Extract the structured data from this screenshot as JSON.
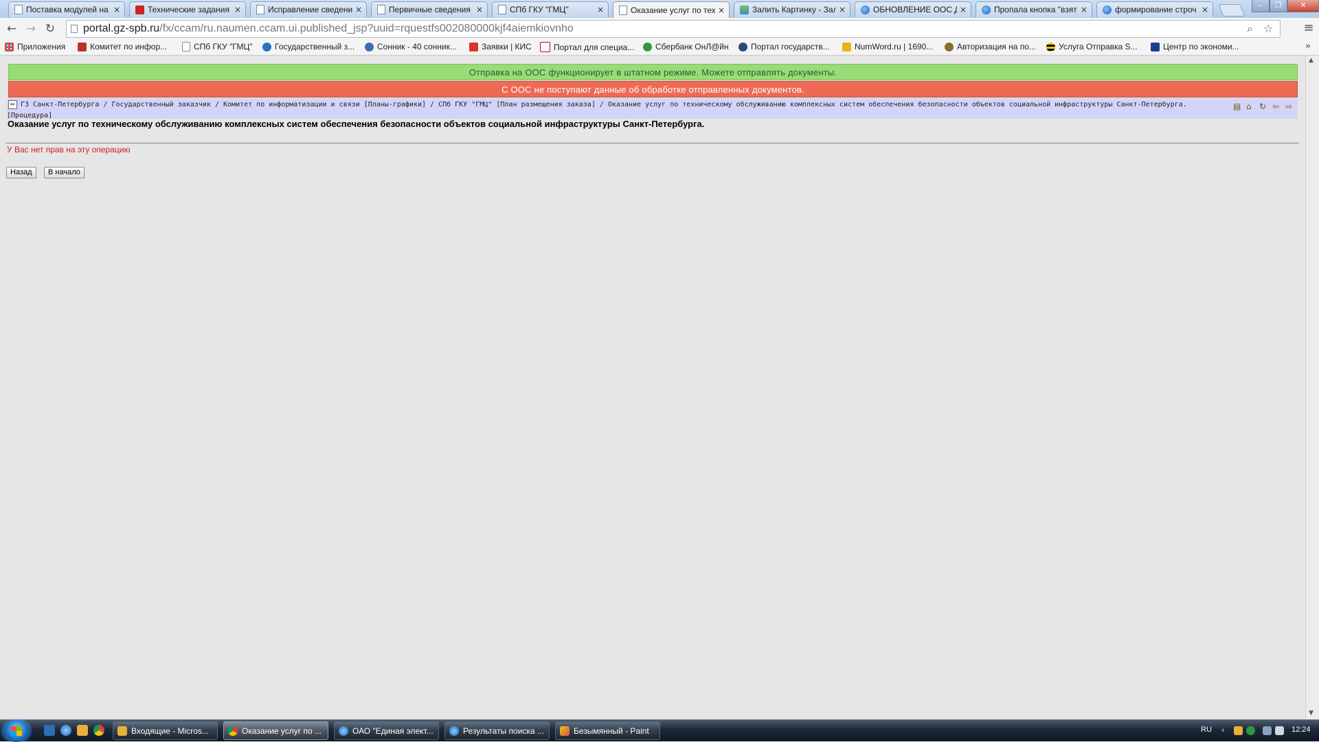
{
  "browser": {
    "tabs": [
      {
        "title": "Поставка модулей на",
        "icon": "document-icon"
      },
      {
        "title": "Технические задания",
        "icon": "red-site-icon"
      },
      {
        "title": "Исправление сведени",
        "icon": "document-icon"
      },
      {
        "title": "Первичные сведения",
        "icon": "document-icon"
      },
      {
        "title": "СПб ГКУ \"ГМЦ\"",
        "icon": "document-icon"
      },
      {
        "title": "Оказание услуг по тех",
        "icon": "document-icon",
        "active": true
      },
      {
        "title": "Залить Картинку - Зал",
        "icon": "image-site-icon"
      },
      {
        "title": "ОБНОВЛЕНИЕ ООС Д",
        "icon": "globe-icon"
      },
      {
        "title": "Пропала кнопка \"взят",
        "icon": "globe-icon"
      },
      {
        "title": "формирование строч",
        "icon": "globe-icon"
      }
    ],
    "tab_close_glyph": "×",
    "address": {
      "host": "portal.gz-spb.ru",
      "path": "/fx/ccam/ru.naumen.ccam.ui.published_jsp?uuid=rquestfs002080000kjf4aiemkiovnho"
    },
    "bookmarks": [
      "Приложения",
      "Комитет по инфор...",
      "СПб ГКУ \"ГМЦ\"",
      "Государственный з...",
      "Сонник - 40 сонник...",
      "Заявки | КИС",
      "Портал для специа...",
      "Сбербанк ОнЛ@йн",
      "Портал государств...",
      "NumWord.ru | 1690...",
      "Авторизация на по...",
      "Услуга Отправка S...",
      "Центр по экономи..."
    ]
  },
  "page": {
    "notice_ok": "Отправка на ООС функционирует в штатном режиме. Можете отправлять документы.",
    "notice_error": "С ООС не поступают данные об обработке отправленных документов.",
    "breadcrumb": "ГЗ Санкт-Петербурга / Государственный заказчик / Комитет по информатизации и связи [Планы-графики] / СПб ГКУ \"ГМЦ\" [План размещения заказа] / Оказание услуг по техническому обслуживанию комплексных систем обеспечения безопасности объектов социальной инфраструктуры Санкт-Петербурга. [Процедура]",
    "title": "Оказание услуг по техническому обслуживанию комплексных систем обеспечения безопасности объектов социальной инфраструктуры Санкт-Петербурга.",
    "error": "У Вас нет прав на эту операцию",
    "back_button": "Назад",
    "home_button": "В начало"
  },
  "taskbar": {
    "windows": [
      {
        "label": "Входящие - Micros..."
      },
      {
        "label": "Оказание услуг по ...",
        "active": true
      },
      {
        "label": "ОАО \"Единая элект..."
      },
      {
        "label": "Результаты поиска ..."
      },
      {
        "label": "Безымянный - Paint"
      }
    ],
    "language": "RU",
    "clock": "12:24"
  },
  "colors": {
    "notice_ok_bg": "#98dc78",
    "notice_error_bg": "#ee6a55",
    "breadcrumb_bg": "#d3d4f8",
    "error_text": "#d21b1b"
  }
}
